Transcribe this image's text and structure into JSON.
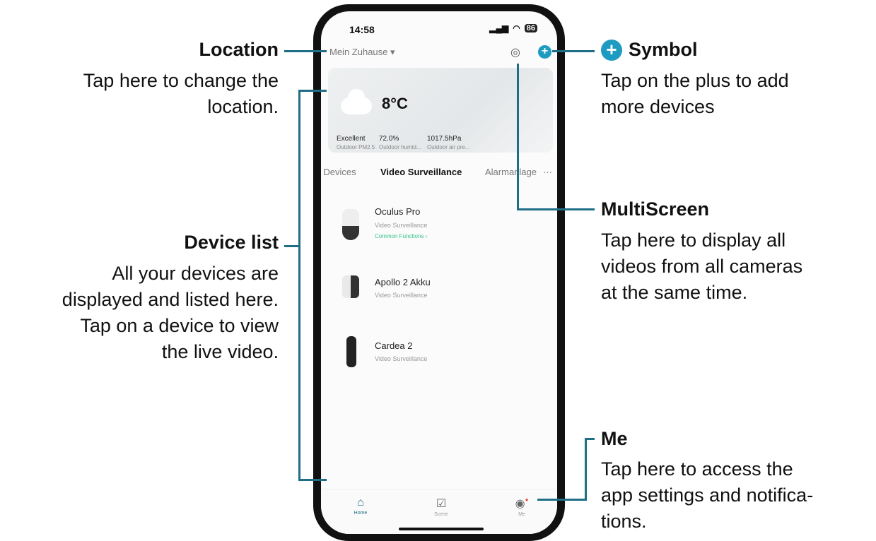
{
  "callouts": {
    "location": {
      "title": "Location",
      "body": [
        "Tap here to change the",
        "location."
      ]
    },
    "symbol": {
      "title": "Symbol",
      "icon": "plus-icon",
      "body": [
        "Tap on the plus to add",
        "more devices"
      ]
    },
    "device_list": {
      "title": "Device list",
      "body": [
        "All your devices are",
        "displayed and listed here.",
        "Tap on a device to view",
        "the live video."
      ]
    },
    "multiscreen": {
      "title": "MultiScreen",
      "body": [
        "Tap here to display all",
        "videos from all cameras",
        "at the same time."
      ]
    },
    "me": {
      "title": "Me",
      "body": [
        "Tap here to access the",
        "app settings and notifica-",
        "tions."
      ]
    }
  },
  "phone": {
    "status_bar": {
      "time": "14:58",
      "signal": "signal-icon",
      "wifi": "wifi-icon",
      "battery": "86"
    },
    "header": {
      "location": "Mein Zuhause",
      "multiscreen_icon": "camera-icon",
      "add_icon": "plus-icon"
    },
    "weather": {
      "temperature": "8°C",
      "metrics": [
        {
          "value": "Excellent",
          "label": "Outdoor PM2.5"
        },
        {
          "value": "72.0%",
          "label": "Outdoor humid..."
        },
        {
          "value": "1017.5hPa",
          "label": "Outdoor air pre..."
        }
      ]
    },
    "tabs": [
      {
        "label": "ll Devices",
        "active": false
      },
      {
        "label": "Video Surveillance",
        "active": true
      },
      {
        "label": "Alarmanlage",
        "active": false
      }
    ],
    "tabs_more": "···",
    "devices": [
      {
        "name": "Oculus Pro",
        "category": "Video Surveillance",
        "functions": "Common Functions ›"
      },
      {
        "name": "Apollo 2 Akku",
        "category": "Video Surveillance"
      },
      {
        "name": "Cardea 2",
        "category": "Video Surveillance"
      }
    ],
    "bottom_nav": [
      {
        "label": "Home",
        "icon": "home-icon",
        "active": true
      },
      {
        "label": "Scene",
        "icon": "checkbox-icon",
        "active": false
      },
      {
        "label": "Me",
        "icon": "profile-icon",
        "active": false
      }
    ]
  },
  "colors": {
    "accent": "#1e6f86",
    "plus": "#1e9bc0",
    "green": "#33c28a"
  }
}
